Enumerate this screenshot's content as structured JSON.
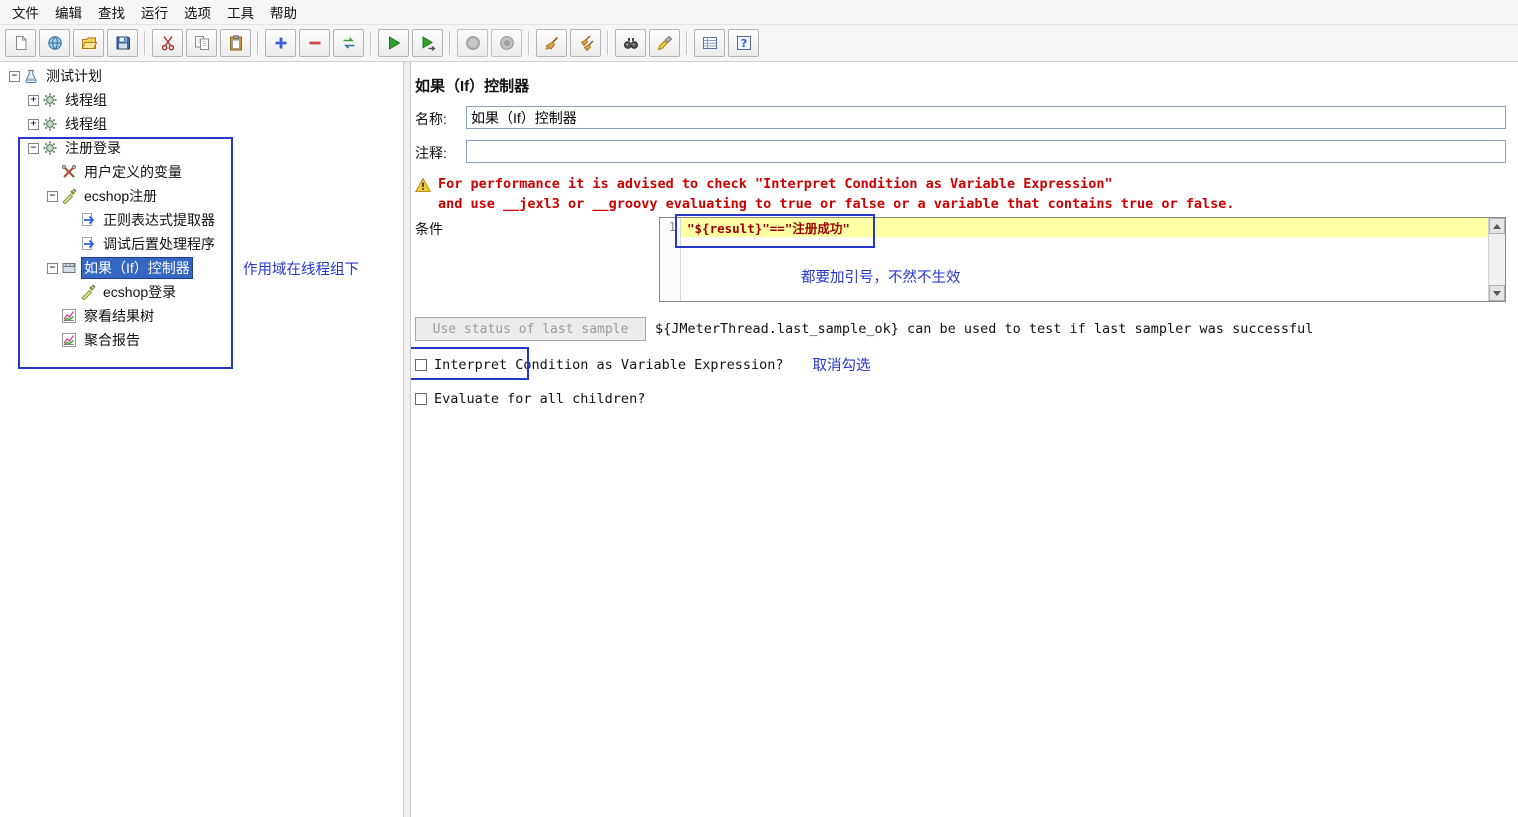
{
  "colors": {
    "annotation_blue": "#2737CE",
    "warning_red": "#CC0000",
    "selection_blue": "#3367C2",
    "condition_highlight": "#FFFFA3",
    "condition_text": "#990000",
    "link_blue": "#2737CE"
  },
  "menu": {
    "items": [
      {
        "name": "file",
        "label": "文件"
      },
      {
        "name": "edit",
        "label": "编辑"
      },
      {
        "name": "search",
        "label": "查找"
      },
      {
        "name": "run",
        "label": "运行"
      },
      {
        "name": "options",
        "label": "选项"
      },
      {
        "name": "tools",
        "label": "工具"
      },
      {
        "name": "help",
        "label": "帮助"
      }
    ]
  },
  "toolbar": {
    "buttons": [
      {
        "name": "new-file"
      },
      {
        "name": "templates"
      },
      {
        "name": "open-file"
      },
      {
        "name": "save"
      },
      {
        "sep": true
      },
      {
        "name": "cut"
      },
      {
        "name": "copy"
      },
      {
        "name": "paste"
      },
      {
        "sep": true
      },
      {
        "name": "expand-all"
      },
      {
        "name": "collapse-all"
      },
      {
        "name": "toggle"
      },
      {
        "sep": true
      },
      {
        "name": "start"
      },
      {
        "name": "start-no-timers"
      },
      {
        "sep": true
      },
      {
        "name": "stop",
        "disabled": true
      },
      {
        "name": "shutdown",
        "disabled": true
      },
      {
        "sep": true
      },
      {
        "name": "clear"
      },
      {
        "name": "clear-all"
      },
      {
        "sep": true
      },
      {
        "name": "search"
      },
      {
        "name": "search-reset"
      },
      {
        "sep": true
      },
      {
        "name": "function-helper"
      },
      {
        "name": "help"
      }
    ]
  },
  "tree": {
    "items": [
      {
        "name": "test-plan",
        "label": "测试计划",
        "level": 0,
        "expander": "minus",
        "icon": "test-plan",
        "selected": false
      },
      {
        "name": "thread-group-1",
        "label": "线程组",
        "level": 1,
        "expander": "plus",
        "icon": "gear",
        "selected": false
      },
      {
        "name": "thread-group-2",
        "label": "线程组",
        "level": 1,
        "expander": "plus",
        "icon": "gear",
        "selected": false
      },
      {
        "name": "register-login-group",
        "label": "注册登录",
        "level": 1,
        "expander": "minus",
        "icon": "gear",
        "selected": false
      },
      {
        "name": "user-defined-variables",
        "label": "用户定义的变量",
        "level": 2,
        "expander": "none",
        "icon": "variables",
        "selected": false
      },
      {
        "name": "ecshop-register",
        "label": "ecshop注册",
        "level": 2,
        "expander": "minus",
        "icon": "sampler",
        "selected": false
      },
      {
        "name": "regex-extractor",
        "label": "正则表达式提取器",
        "level": 3,
        "expander": "none",
        "icon": "arrow-doc",
        "selected": false
      },
      {
        "name": "debug-postprocessor",
        "label": "调试后置处理程序",
        "level": 3,
        "expander": "none",
        "icon": "arrow-doc",
        "selected": false
      },
      {
        "name": "if-controller",
        "label": "如果（If）控制器",
        "level": 2,
        "expander": "minus",
        "icon": "controller",
        "selected": true
      },
      {
        "name": "ecshop-login",
        "label": "ecshop登录",
        "level": 3,
        "expander": "none",
        "icon": "sampler",
        "selected": false
      },
      {
        "name": "view-results-tree",
        "label": "察看结果树",
        "level": 2,
        "expander": "none",
        "icon": "chart",
        "selected": false
      },
      {
        "name": "aggregate-report",
        "label": "聚合报告",
        "level": 2,
        "expander": "none",
        "icon": "chart",
        "selected": false
      }
    ]
  },
  "annotations": {
    "scope_note": "作用域在线程组下",
    "quote_note": "都要加引号，不然不生效",
    "uncheck_note": "取消勾选"
  },
  "main": {
    "title": "如果（If）控制器",
    "name_label": "名称:",
    "name_value": "如果（If）控制器",
    "comment_label": "注释:",
    "comment_value": "",
    "warning": {
      "line1": "For performance it is advised to check \"Interpret Condition as Variable Expression\"",
      "line2": "and use __jexl3 or __groovy evaluating to true or false or a variable that contains true or false."
    },
    "condition": {
      "label": "条件",
      "line_number": "1",
      "value": "\"${result}\"==\"注册成功\""
    },
    "use_status_button": "Use status of last sample",
    "status_hint": "${JMeterThread.last_sample_ok} can be used to test if last sampler was successful",
    "interpret_label": "Interpret Condition as Variable Expression?",
    "interpret_checked": false,
    "evaluate_label": "Evaluate for all children?",
    "evaluate_checked": false
  }
}
